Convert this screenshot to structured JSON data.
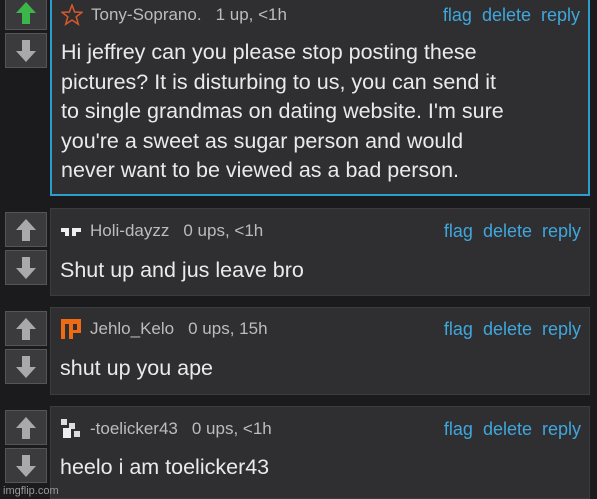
{
  "comments": [
    {
      "username": "Tony-Soprano.",
      "points": "1 up, <1h",
      "text_lines": [
        "Hi jeffrey can you please stop posting these",
        "pictures? It is disturbing to us, you can send it",
        "to single grandmas on dating website. I'm sure",
        "you're a sweet as sugar person and would",
        "never want to be viewed as a bad person."
      ],
      "upvoted": true
    },
    {
      "username": "Holi-dayzz",
      "points": "0 ups, <1h",
      "text_lines": [
        "Shut up and jus leave bro"
      ],
      "upvoted": false
    },
    {
      "username": "Jehlo_Kelo",
      "points": "0 ups, 15h",
      "text_lines": [
        "shut up you ape"
      ],
      "upvoted": false
    },
    {
      "username": "-toelicker43",
      "points": "0 ups, <1h",
      "text_lines": [
        "heelo i am toelicker43"
      ],
      "upvoted": false
    }
  ],
  "actions": {
    "flag": "flag",
    "delete": "delete",
    "reply": "reply"
  },
  "watermark": "imgflip.com",
  "colors": {
    "link": "#3fa7dd",
    "highlight_border": "#2a9fcf",
    "upvote_active": "#3cb54a"
  }
}
